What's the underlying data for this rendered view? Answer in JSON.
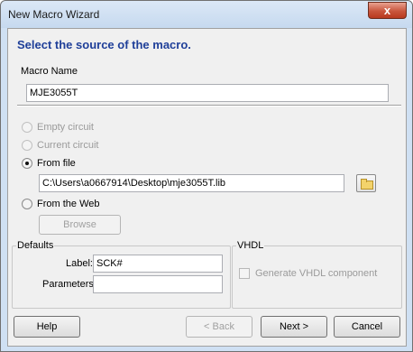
{
  "window": {
    "title": "New Macro Wizard",
    "close_glyph": "x"
  },
  "heading": "Select the source of the macro.",
  "macro_name": {
    "label": "Macro Name",
    "value": "MJE3055T"
  },
  "source_options": [
    {
      "label": "Empty circuit",
      "enabled": false,
      "selected": false
    },
    {
      "label": "Current circuit",
      "enabled": false,
      "selected": false
    },
    {
      "label": "From file",
      "enabled": true,
      "selected": true
    },
    {
      "label": "From the Web",
      "enabled": true,
      "selected": false
    }
  ],
  "file_path": "C:\\Users\\a0667914\\Desktop\\mje3055T.lib",
  "browse_button": "Browse",
  "defaults": {
    "title": "Defaults",
    "label_caption": "Label:",
    "label_value": "SCK#",
    "parameters_caption": "Parameters:",
    "parameters_value": ""
  },
  "vhdl": {
    "title": "VHDL",
    "checkbox_label": "Generate VHDL component",
    "checked": false
  },
  "buttons": {
    "help": "Help",
    "back": "< Back",
    "next": "Next >",
    "cancel": "Cancel"
  },
  "icons": {
    "folder": "folder-open-icon"
  }
}
